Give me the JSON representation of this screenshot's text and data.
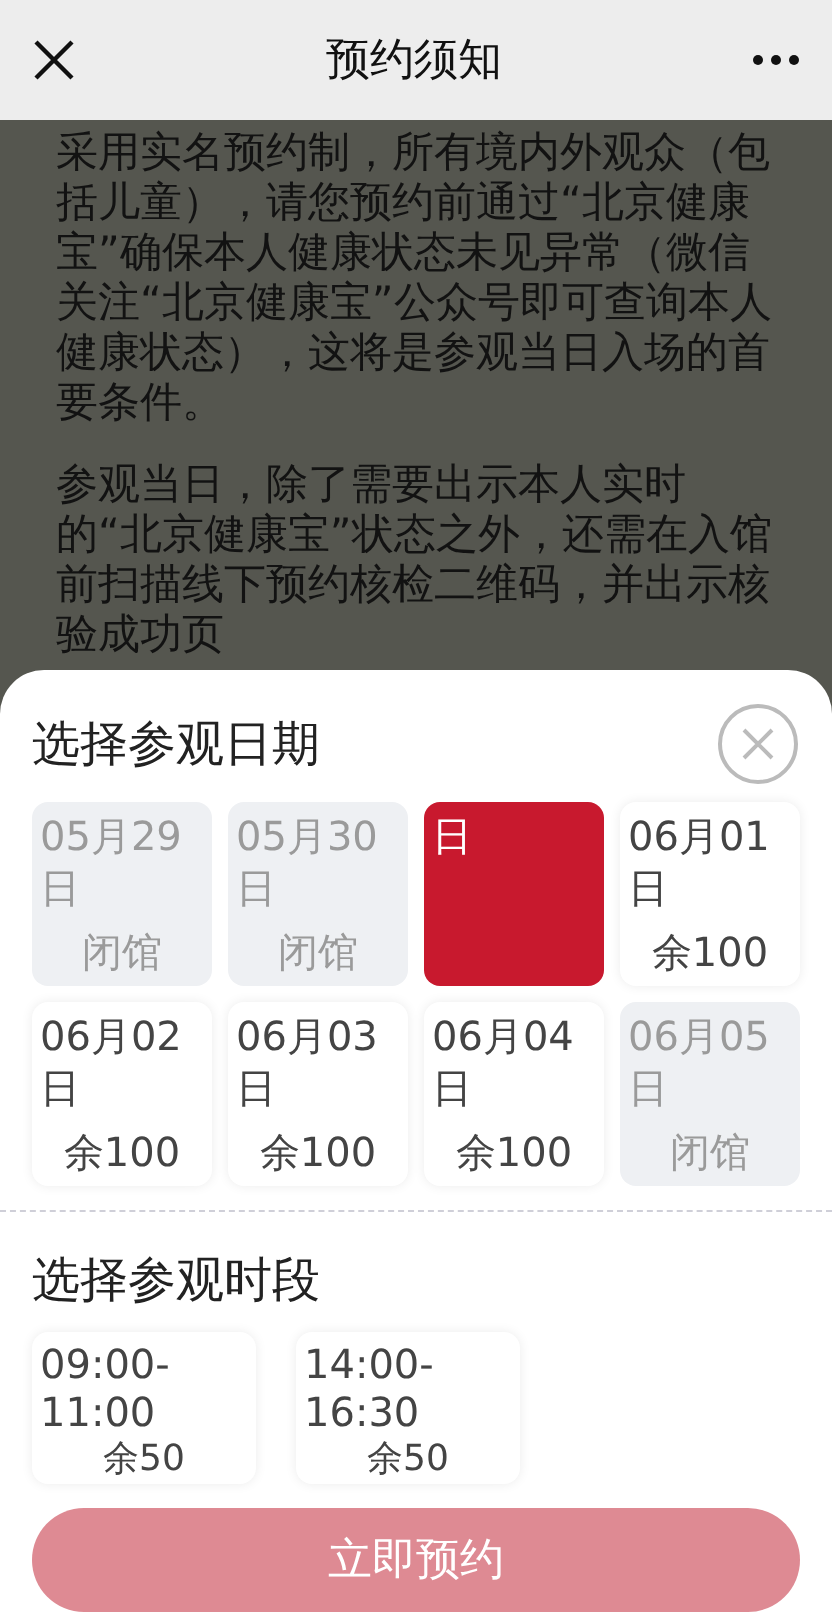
{
  "header": {
    "title": "预约须知"
  },
  "notice": {
    "paragraphs": [
      "采用实名预约制，所有境内外观众（包括儿童），请您预约前通过“北京健康宝”确保本人健康状态未见异常（微信关注“北京健康宝”公众号即可查询本人健康状态），这将是参观当日入场的首要条件。",
      "参观当日，除了需要出示本人实时的“北京健康宝”状态之外，还需在入馆前扫描线下预约核检二维码，并出示核验成功页"
    ]
  },
  "date_picker": {
    "title": "选择参观日期",
    "dates": [
      {
        "date": "05月29日",
        "status": "闭馆",
        "closed": true,
        "selected": false
      },
      {
        "date": "05月30日",
        "status": "闭馆",
        "closed": true,
        "selected": false
      },
      {
        "date": "日",
        "closed": false,
        "selected": true
      },
      {
        "date": "06月01日",
        "status": "余100",
        "closed": false,
        "selected": false
      },
      {
        "date": "06月02日",
        "status": "余100",
        "closed": false,
        "selected": false
      },
      {
        "date": "06月03日",
        "status": "余100",
        "closed": false,
        "selected": false
      },
      {
        "date": "06月04日",
        "status": "余100",
        "closed": false,
        "selected": false
      },
      {
        "date": "06月05日",
        "status": "闭馆",
        "closed": true,
        "selected": false
      }
    ]
  },
  "time_picker": {
    "title": "选择参观时段",
    "slots": [
      {
        "time": "09:00-11:00",
        "status": "余50",
        "selected": false
      },
      {
        "time": "14:00-16:30",
        "status": "余50",
        "selected": false
      }
    ]
  },
  "submit_button": {
    "label": "立即预约",
    "disabled": true
  }
}
